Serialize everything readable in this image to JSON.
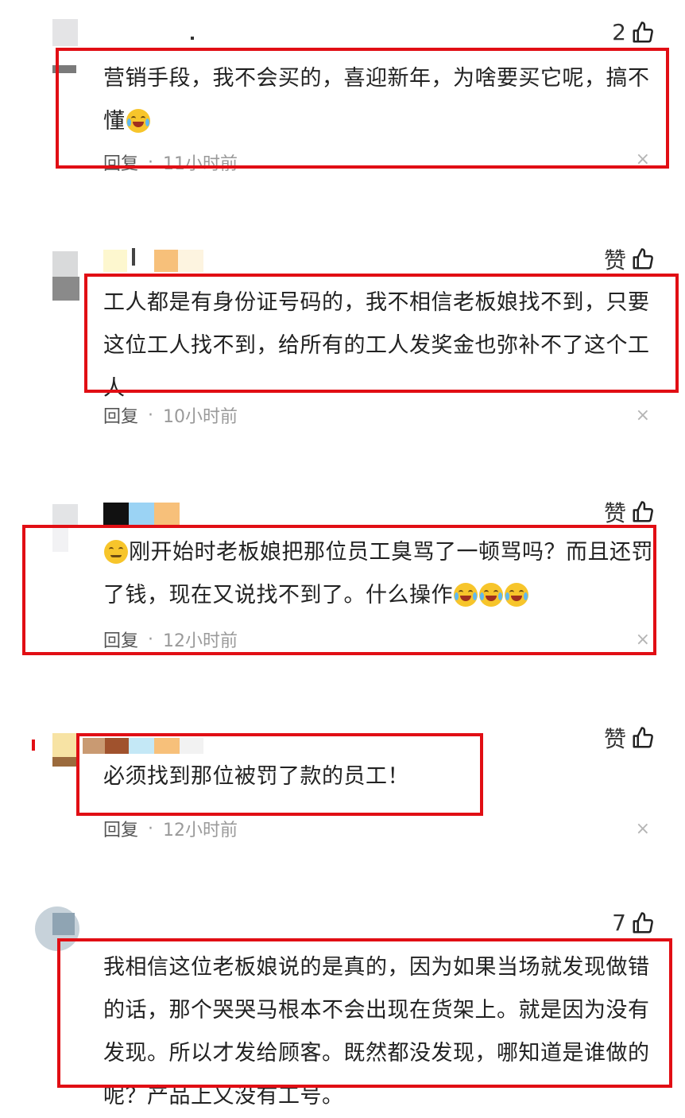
{
  "comments": [
    {
      "likes": "2",
      "text_parts": [
        "营销手段，我不会买的，喜迎新年，为啥要买它呢，搞不懂",
        ""
      ],
      "reply": "回复",
      "dot": "·",
      "time": "11小时前",
      "close": "×"
    },
    {
      "likes": "赞",
      "text": "工人都是有身份证号码的，我不相信老板娘找不到，只要这位工人找不到，给所有的工人发奖金也弥补不了这个工人",
      "reply": "回复",
      "dot": "·",
      "time": "10小时前",
      "close": "×"
    },
    {
      "likes": "赞",
      "text_parts": [
        "",
        "刚开始时老板娘把那位员工臭骂了一顿骂吗？而且还罚了钱，现在又说找不到了。什么操作"
      ],
      "reply": "回复",
      "dot": "·",
      "time": "12小时前",
      "close": "×"
    },
    {
      "likes": "赞",
      "text": "必须找到那位被罚了款的员工！",
      "reply": "回复",
      "dot": "·",
      "time": "12小时前",
      "close": "×"
    },
    {
      "likes": "7",
      "text": "我相信这位老板娘说的是真的，因为如果当场就发现做错的话，那个哭哭马根本不会出现在货架上。就是因为没有发现。所以才发给顾客。既然都没发现，哪知道是谁做的呢？产品上又没有工号。"
    }
  ],
  "icons": {
    "like": "thumbs-up-icon",
    "emoji_laugh_cry": "laugh-cry-emoji-icon",
    "emoji_squint": "squint-emoji-icon",
    "close": "close-icon"
  },
  "colors": {
    "highlight_box": "#e10e14",
    "meta_text": "#9a9a9a"
  }
}
